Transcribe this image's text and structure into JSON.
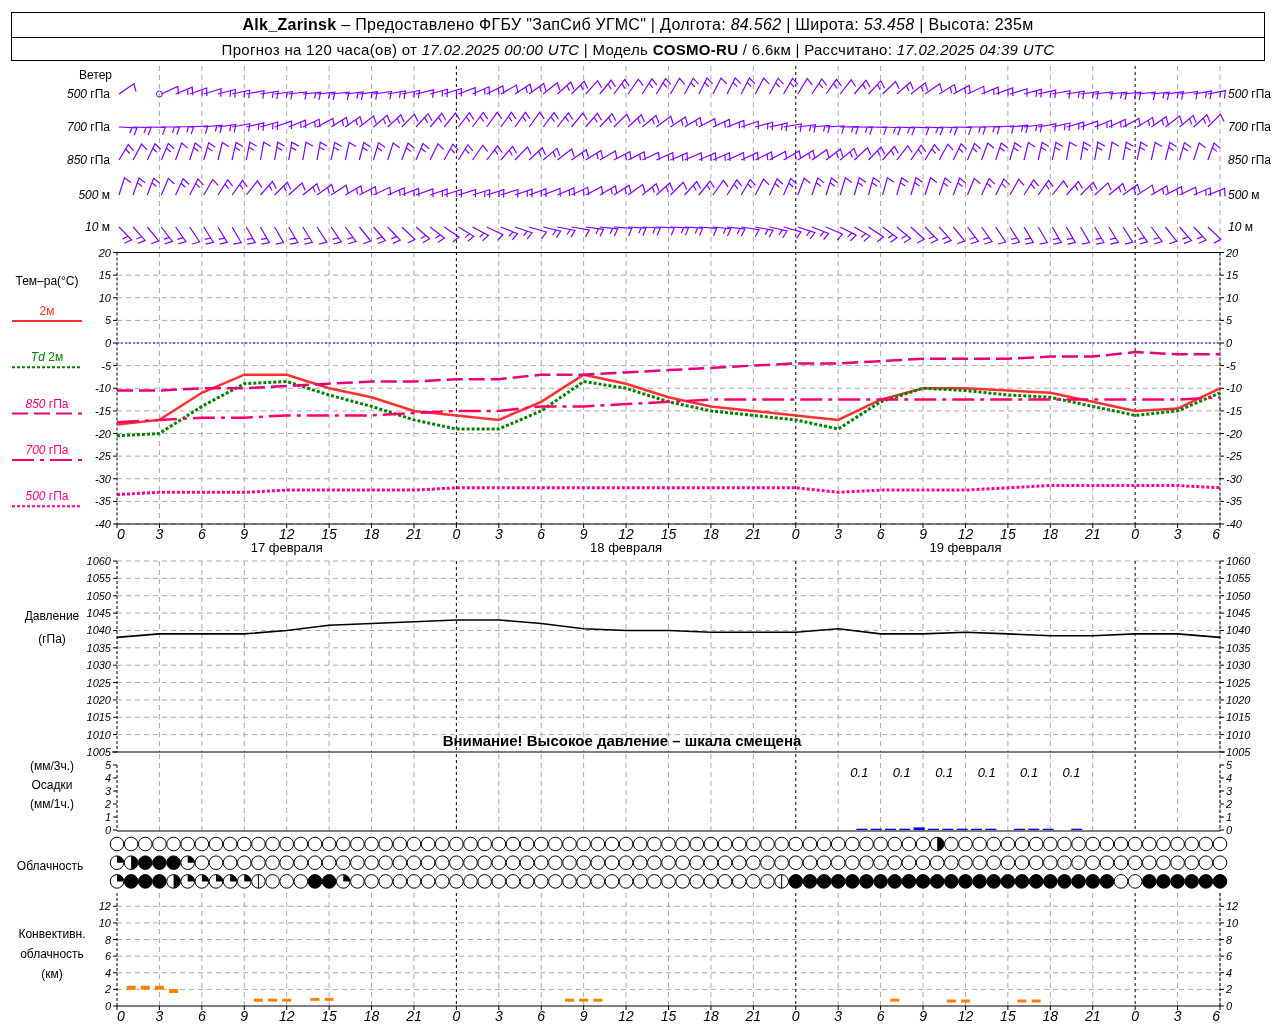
{
  "header": {
    "line_1": "**Alk_Zarinsk** – Предоставлено ФГБУ \"ЗапСиб УГМС\" | Долгота: *84.562* | Широта: *53.458* | Высота: 235м",
    "line_2": "Прогноз на 120 часа(ов) от *17.02.2025 00:00 UTC* | Модель **COSMO-RU** / 6.6км | Рассчитано: *17.02.2025 04:39 UTC*"
  },
  "wind": {
    "title": "Ветер",
    "levels": [
      {
        "label_left": "*500* гПа",
        "label_right": "*500* гПа"
      },
      {
        "label_left": "*700* гПа",
        "label_right": "*700* гПа"
      },
      {
        "label_left": "*850* гПа",
        "label_right": "*850* гПа"
      },
      {
        "label_left": "*500* м",
        "label_right": "*500* м"
      },
      {
        "label_left": "*10* м",
        "label_right": "*10* м"
      }
    ]
  },
  "temperature": {
    "title": "Тем–ра(°C)",
    "days": [
      "17 февраля",
      "18 февраля",
      "19 февраля"
    ],
    "right_axis_labels": [
      "20",
      "15",
      "10",
      "5",
      "0",
      "-5",
      "-10",
      "-15",
      "-20",
      "-25",
      "-30",
      "-35",
      "-40"
    ],
    "chart_data": {
      "type": "line",
      "categories": [
        "0",
        "3",
        "6",
        "9",
        "12",
        "15",
        "18",
        "21",
        "0",
        "3",
        "6",
        "9",
        "12",
        "15",
        "18",
        "21",
        "0",
        "3",
        "6",
        "9",
        "12",
        "15",
        "18",
        "21",
        "0",
        "3",
        "6"
      ],
      "ylim": [
        -40,
        20
      ],
      "yticks": [
        20,
        15,
        10,
        5,
        0,
        -5,
        -10,
        -15,
        -20,
        -25,
        -30,
        -35,
        -40
      ],
      "grid": true,
      "ref_lines": [
        {
          "axis": "y",
          "value": 0,
          "color": "#0000ff"
        }
      ],
      "series": [
        {
          "name": "2м",
          "line_style": "solid",
          "color": "#ff3030",
          "values": [
            -18,
            -17,
            -11,
            -7,
            -7,
            -10,
            -12,
            -15,
            -16,
            -17,
            -13,
            -7,
            -9,
            -12,
            -14,
            -15,
            -16,
            -17,
            -12.5,
            -10,
            -10,
            -10.5,
            -11,
            -13,
            -15,
            -14.5,
            -10
          ]
        },
        {
          "name": "*Td* 2м",
          "line_style": "dotted",
          "color": "#008000",
          "values": [
            -20.5,
            -20,
            -14,
            -9,
            -8.5,
            -11.5,
            -14,
            -17,
            -19,
            -19,
            -15,
            -8.5,
            -10,
            -13,
            -15,
            -16,
            -17,
            -19,
            -13,
            -10,
            -10.5,
            -11.5,
            -12,
            -14,
            -16,
            -15,
            -11
          ]
        },
        {
          "name": "*850* гПа",
          "line_style": "dashed",
          "color": "#e6007e",
          "values": [
            -10.5,
            -10.5,
            -10,
            -10,
            -9.5,
            -9,
            -8.5,
            -8.5,
            -8,
            -8,
            -7,
            -7,
            -6.5,
            -6,
            -5.5,
            -5,
            -4.5,
            -4.5,
            -4,
            -3.5,
            -3.5,
            -3.5,
            -3,
            -3,
            -2,
            -2.5,
            -2.5
          ]
        },
        {
          "name": "*700* гПа",
          "line_style": "dashdot",
          "color": "#ff0066",
          "values": [
            -17.5,
            -17,
            -16.5,
            -16.5,
            -16,
            -16,
            -16,
            -15.5,
            -15,
            -15,
            -14,
            -14,
            -13.5,
            -13,
            -12.5,
            -12.5,
            -12.5,
            -12.5,
            -12.5,
            -12.5,
            -12.5,
            -12.5,
            -12.5,
            -12.5,
            -12.5,
            -12.5,
            -12
          ]
        },
        {
          "name": "*500* гПа",
          "line_style": "dotted",
          "color": "#ff0099",
          "values": [
            -33.5,
            -33,
            -33,
            -33,
            -32.5,
            -32.5,
            -32.5,
            -32.5,
            -32,
            -32,
            -32,
            -32,
            -32,
            -32,
            -32,
            -32,
            -32,
            -33,
            -32.5,
            -32.5,
            -32.5,
            -32,
            -31.5,
            -31.5,
            -31.5,
            -31.5,
            -32
          ]
        }
      ]
    }
  },
  "pressure": {
    "title": "Давление",
    "unit": "(гПа)",
    "warning": "Внимание! Высокое давление – шкала смещена",
    "right_axis_labels": [
      "1060",
      "1055",
      "1050",
      "1045",
      "1040",
      "1035",
      "1030",
      "1025",
      "1020",
      "1015",
      "1010",
      "1005"
    ],
    "chart_data": {
      "type": "line",
      "categories": [
        null,
        null,
        null,
        null,
        null,
        null,
        null,
        null,
        null,
        null,
        null,
        null,
        null,
        null,
        null,
        null,
        null,
        null,
        null,
        null,
        null,
        null,
        null,
        null,
        null,
        null,
        null
      ],
      "ylim": [
        1005,
        1060
      ],
      "yticks": [
        1060,
        1055,
        1050,
        1045,
        1040,
        1035,
        1030,
        1025,
        1020,
        1015,
        1010,
        1005
      ],
      "grid": true,
      "series": [
        {
          "color": "#000000",
          "values": [
            1038,
            1039,
            1039,
            1039,
            1040,
            1041.5,
            1042,
            1042.5,
            1043,
            1043,
            1042,
            1040.5,
            1040,
            1040,
            1039.5,
            1039.5,
            1039.5,
            1040.5,
            1039,
            1039,
            1039.5,
            1039,
            1038.5,
            1038.5,
            1039,
            1039,
            1038
          ]
        }
      ]
    }
  },
  "precipitation": {
    "unit_3h": "(мм/3ч.)",
    "title": "Осадки",
    "unit_1h": "(мм/1ч.)",
    "right_axis_labels": [
      "5",
      "4",
      "3",
      "2",
      "1",
      "0"
    ],
    "chart_data": {
      "type": "bar",
      "categories": [
        null,
        null,
        null,
        null,
        null,
        null,
        null,
        null,
        null,
        null,
        null,
        null,
        null,
        null,
        null,
        null,
        null,
        null,
        null,
        null,
        null,
        null,
        null,
        null,
        null,
        null,
        null,
        null,
        null,
        null,
        null,
        null,
        null,
        null,
        null,
        null,
        null,
        null,
        null,
        null,
        null,
        null,
        null,
        null,
        null,
        null,
        null,
        null,
        null,
        null,
        null,
        null,
        null,
        null,
        null,
        null,
        null,
        null,
        null,
        null,
        null,
        null,
        null,
        null,
        null,
        null,
        null,
        null,
        null,
        null,
        null,
        null,
        null,
        null,
        null,
        null,
        null,
        null
      ],
      "ylim": [
        0,
        5
      ],
      "yticks": [
        5,
        4,
        3,
        2,
        1,
        0
      ],
      "grid": true,
      "series": [
        {
          "color": "#0000ff",
          "values": [
            0,
            0,
            0,
            0,
            0,
            0,
            0,
            0,
            0,
            0,
            0,
            0,
            0,
            0,
            0,
            0,
            0,
            0,
            0,
            0,
            0,
            0,
            0,
            0,
            0,
            0,
            0,
            0,
            0,
            0,
            0,
            0,
            0,
            0,
            0,
            0,
            0,
            0,
            0,
            0,
            0,
            0,
            0,
            0,
            0,
            0,
            0,
            0,
            0,
            0,
            0,
            0,
            0.1,
            0.1,
            0.1,
            0.1,
            0.2,
            0.1,
            0.1,
            0.1,
            0.1,
            0.1,
            0,
            0.1,
            0.1,
            0.1,
            0,
            0.1,
            0,
            0,
            0,
            0,
            0,
            0,
            0,
            0,
            0,
            0
          ]
        }
      ],
      "annotations": [
        "0.1",
        "0.1",
        "0.1",
        "0.1",
        "0.1",
        "0.1"
      ]
    }
  },
  "cloudiness": {
    "title": "Облачность",
    "rows": [
      {
        "cells": [
          {
            "kind": "clear"
          },
          {
            "kind": "clear"
          },
          {
            "kind": "clear"
          },
          {
            "kind": "clear"
          },
          {
            "kind": "clear"
          },
          {
            "kind": "clear"
          },
          {
            "kind": "clear"
          },
          {
            "kind": "clear"
          },
          {
            "kind": "clear"
          },
          {
            "kind": "clear"
          },
          {
            "kind": "clear"
          },
          {
            "kind": "clear"
          },
          {
            "kind": "clear"
          },
          {
            "kind": "clear"
          },
          {
            "kind": "clear"
          },
          {
            "kind": "clear"
          },
          {
            "kind": "clear"
          },
          {
            "kind": "clear"
          },
          {
            "kind": "clear"
          },
          {
            "kind": "clear"
          },
          {
            "kind": "clear"
          },
          {
            "kind": "clear"
          },
          {
            "kind": "clear"
          },
          {
            "kind": "clear"
          },
          {
            "kind": "clear"
          },
          {
            "kind": "clear"
          },
          {
            "kind": "clear"
          },
          {
            "kind": "clear"
          },
          {
            "kind": "clear"
          },
          {
            "kind": "clear"
          },
          {
            "kind": "clear"
          },
          {
            "kind": "clear"
          },
          {
            "kind": "clear"
          },
          {
            "kind": "clear"
          },
          {
            "kind": "clear"
          },
          {
            "kind": "clear"
          },
          {
            "kind": "clear"
          },
          {
            "kind": "clear"
          },
          {
            "kind": "clear"
          },
          {
            "kind": "clear"
          },
          {
            "kind": "clear"
          },
          {
            "kind": "clear"
          },
          {
            "kind": "clear"
          },
          {
            "kind": "clear"
          },
          {
            "kind": "clear"
          },
          {
            "kind": "clear"
          },
          {
            "kind": "clear"
          },
          {
            "kind": "clear"
          },
          {
            "kind": "clear"
          },
          {
            "kind": "clear"
          },
          {
            "kind": "clear"
          },
          {
            "kind": "clear"
          },
          {
            "kind": "clear"
          },
          {
            "kind": "clear"
          },
          {
            "kind": "clear"
          },
          {
            "kind": "clear"
          },
          {
            "kind": "clear"
          },
          {
            "kind": "clear"
          },
          {
            "kind": "half"
          },
          {
            "kind": "clear"
          },
          {
            "kind": "clear"
          },
          {
            "kind": "clear"
          },
          {
            "kind": "clear"
          },
          {
            "kind": "clear"
          },
          {
            "kind": "clear"
          },
          {
            "kind": "clear"
          },
          {
            "kind": "clear"
          },
          {
            "kind": "clear"
          },
          {
            "kind": "clear"
          },
          {
            "kind": "clear"
          },
          {
            "kind": "clear"
          },
          {
            "kind": "clear"
          },
          {
            "kind": "clear"
          },
          {
            "kind": "clear"
          },
          {
            "kind": "clear"
          },
          {
            "kind": "clear"
          },
          {
            "kind": "clear"
          },
          {
            "kind": "clear"
          },
          {
            "kind": "clear"
          }
        ]
      },
      {
        "cells": [
          {
            "kind": "few"
          },
          {
            "kind": "half"
          },
          {
            "kind": "overcast"
          },
          {
            "kind": "overcast"
          },
          {
            "kind": "overcast"
          },
          {
            "kind": "few"
          },
          {
            "kind": "clear"
          },
          {
            "kind": "clear"
          },
          {
            "kind": "clear"
          },
          {
            "kind": "clear"
          },
          {
            "kind": "clear"
          },
          {
            "kind": "clear"
          },
          {
            "kind": "clear"
          },
          {
            "kind": "clear"
          },
          {
            "kind": "clear"
          },
          {
            "kind": "clear"
          },
          {
            "kind": "clear"
          },
          {
            "kind": "clear"
          },
          {
            "kind": "clear"
          },
          {
            "kind": "clear"
          },
          {
            "kind": "clear"
          },
          {
            "kind": "clear"
          },
          {
            "kind": "clear"
          },
          {
            "kind": "clear"
          },
          {
            "kind": "clear"
          },
          {
            "kind": "clear"
          },
          {
            "kind": "clear"
          },
          {
            "kind": "clear"
          },
          {
            "kind": "clear"
          },
          {
            "kind": "clear"
          },
          {
            "kind": "clear"
          },
          {
            "kind": "clear"
          },
          {
            "kind": "clear"
          },
          {
            "kind": "clear"
          },
          {
            "kind": "clear"
          },
          {
            "kind": "clear"
          },
          {
            "kind": "clear"
          },
          {
            "kind": "clear"
          },
          {
            "kind": "clear"
          },
          {
            "kind": "clear"
          },
          {
            "kind": "clear"
          },
          {
            "kind": "clear"
          },
          {
            "kind": "clear"
          },
          {
            "kind": "clear"
          },
          {
            "kind": "clear"
          },
          {
            "kind": "clear"
          },
          {
            "kind": "clear"
          },
          {
            "kind": "clear"
          },
          {
            "kind": "clear"
          },
          {
            "kind": "clear"
          },
          {
            "kind": "clear"
          },
          {
            "kind": "clear"
          },
          {
            "kind": "clear"
          },
          {
            "kind": "clear"
          },
          {
            "kind": "clear"
          },
          {
            "kind": "clear"
          },
          {
            "kind": "clear"
          },
          {
            "kind": "clear"
          },
          {
            "kind": "clear"
          },
          {
            "kind": "clear"
          },
          {
            "kind": "clear"
          },
          {
            "kind": "clear"
          },
          {
            "kind": "clear"
          },
          {
            "kind": "clear"
          },
          {
            "kind": "clear"
          },
          {
            "kind": "clear"
          },
          {
            "kind": "clear"
          },
          {
            "kind": "clear"
          },
          {
            "kind": "clear"
          },
          {
            "kind": "clear"
          },
          {
            "kind": "clear"
          },
          {
            "kind": "clear"
          },
          {
            "kind": "clear"
          },
          {
            "kind": "clear"
          },
          {
            "kind": "clear"
          },
          {
            "kind": "clear"
          },
          {
            "kind": "clear"
          },
          {
            "kind": "clear"
          },
          {
            "kind": "clear"
          }
        ]
      },
      {
        "cells": [
          {
            "kind": "few"
          },
          {
            "kind": "overcast"
          },
          {
            "kind": "overcast"
          },
          {
            "kind": "overcast"
          },
          {
            "kind": "half"
          },
          {
            "kind": "few"
          },
          {
            "kind": "few"
          },
          {
            "kind": "few"
          },
          {
            "kind": "few"
          },
          {
            "kind": "few"
          },
          {
            "kind": "trace"
          },
          {
            "kind": "clear"
          },
          {
            "kind": "clear"
          },
          {
            "kind": "clear"
          },
          {
            "kind": "overcast"
          },
          {
            "kind": "overcast"
          },
          {
            "kind": "few"
          },
          {
            "kind": "clear"
          },
          {
            "kind": "clear"
          },
          {
            "kind": "clear"
          },
          {
            "kind": "clear"
          },
          {
            "kind": "clear"
          },
          {
            "kind": "clear"
          },
          {
            "kind": "clear"
          },
          {
            "kind": "clear"
          },
          {
            "kind": "clear"
          },
          {
            "kind": "clear"
          },
          {
            "kind": "clear"
          },
          {
            "kind": "clear"
          },
          {
            "kind": "clear"
          },
          {
            "kind": "clear"
          },
          {
            "kind": "clear"
          },
          {
            "kind": "clear"
          },
          {
            "kind": "clear"
          },
          {
            "kind": "clear"
          },
          {
            "kind": "clear"
          },
          {
            "kind": "clear"
          },
          {
            "kind": "clear"
          },
          {
            "kind": "clear"
          },
          {
            "kind": "clear"
          },
          {
            "kind": "clear"
          },
          {
            "kind": "clear"
          },
          {
            "kind": "clear"
          },
          {
            "kind": "clear"
          },
          {
            "kind": "clear"
          },
          {
            "kind": "clear"
          },
          {
            "kind": "clear"
          },
          {
            "kind": "trace"
          },
          {
            "kind": "overcast"
          },
          {
            "kind": "overcast"
          },
          {
            "kind": "overcast"
          },
          {
            "kind": "overcast"
          },
          {
            "kind": "overcast"
          },
          {
            "kind": "overcast"
          },
          {
            "kind": "overcast"
          },
          {
            "kind": "overcast"
          },
          {
            "kind": "overcast"
          },
          {
            "kind": "overcast"
          },
          {
            "kind": "overcast"
          },
          {
            "kind": "overcast"
          },
          {
            "kind": "overcast"
          },
          {
            "kind": "overcast"
          },
          {
            "kind": "overcast"
          },
          {
            "kind": "overcast"
          },
          {
            "kind": "overcast"
          },
          {
            "kind": "overcast"
          },
          {
            "kind": "overcast"
          },
          {
            "kind": "overcast"
          },
          {
            "kind": "overcast"
          },
          {
            "kind": "overcast"
          },
          {
            "kind": "overcast"
          },
          {
            "kind": "clear"
          },
          {
            "kind": "clear"
          },
          {
            "kind": "overcast"
          },
          {
            "kind": "overcast"
          },
          {
            "kind": "overcast"
          },
          {
            "kind": "overcast"
          },
          {
            "kind": "overcast"
          },
          {
            "kind": "overcast"
          }
        ]
      }
    ]
  },
  "convective": {
    "title_1": "Конвективн.",
    "title_2": "облачность",
    "unit": "(км)",
    "right_axis_labels": [
      "12",
      "10",
      "8",
      "6",
      "4",
      "2",
      "0"
    ],
    "chart_data": {
      "type": "scatter",
      "categories": [
        "0",
        null,
        null,
        "3",
        null,
        null,
        "6",
        null,
        null,
        "9",
        null,
        null,
        "12",
        null,
        null,
        "15",
        null,
        null,
        "18",
        null,
        null,
        "21",
        null,
        null,
        "0",
        null,
        null,
        "3",
        null,
        null,
        "6",
        null,
        null,
        "9",
        null,
        null,
        "12",
        null,
        null,
        "15",
        null,
        null,
        "18",
        null,
        null,
        "21",
        null,
        null,
        "0",
        null,
        null,
        "3",
        null,
        null,
        "6",
        null,
        null,
        "9",
        null,
        null,
        "12",
        null,
        null,
        "15",
        null,
        null,
        "18",
        null,
        null,
        "21",
        null,
        null,
        "0",
        null,
        null,
        "3",
        null,
        null,
        "6"
      ],
      "ylim": [
        0,
        13.6
      ],
      "yticks": [
        12,
        10,
        8,
        6,
        4,
        2,
        0
      ],
      "grid": true,
      "series": [
        {
          "color": "#ff8000",
          "values": [
            null,
            2.2,
            2.2,
            2.2,
            1.8,
            null,
            null,
            null,
            null,
            null,
            0.7,
            0.7,
            0.7,
            null,
            0.8,
            0.8,
            null,
            null,
            null,
            null,
            null,
            null,
            null,
            null,
            null,
            null,
            null,
            null,
            null,
            null,
            null,
            null,
            0.7,
            0.7,
            0.7,
            null,
            null,
            null,
            null,
            null,
            null,
            null,
            null,
            null,
            null,
            null,
            null,
            null,
            null,
            null,
            null,
            null,
            null,
            null,
            null,
            0.7,
            null,
            null,
            null,
            0.6,
            0.6,
            null,
            null,
            null,
            0.6,
            0.6,
            null,
            null,
            null,
            null,
            null,
            null,
            null,
            null,
            null,
            null,
            null,
            null,
            null
          ]
        }
      ]
    }
  }
}
